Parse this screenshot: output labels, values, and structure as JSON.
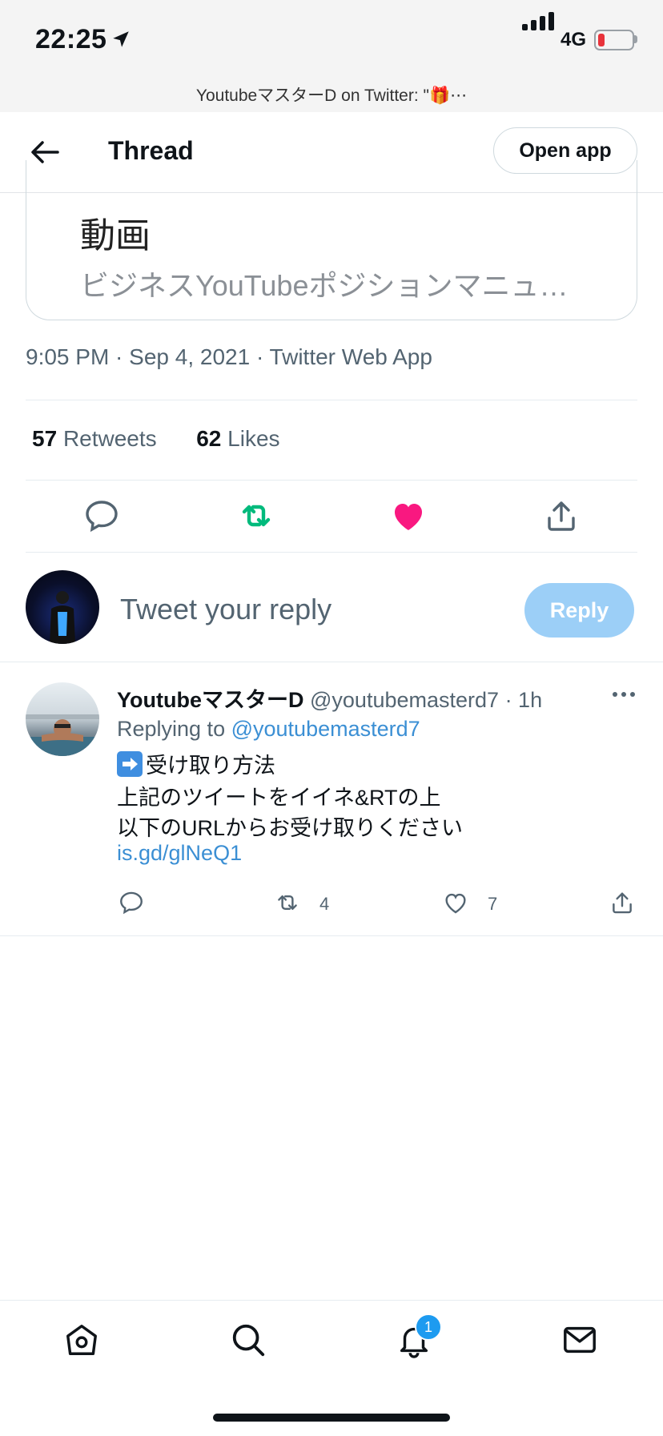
{
  "status_bar": {
    "time": "22:25",
    "network": "4G"
  },
  "browser": {
    "page_title": "Youtubeマスター‌D on Twitter: \"🎁⋯"
  },
  "header": {
    "title": "Thread",
    "open_app": "Open app"
  },
  "card": {
    "title": "動画",
    "description": "ビジネスYouTubeポジションマニュ…"
  },
  "tweet_meta": "9:05 PM · Sep 4, 2021 · Twitter Web App",
  "stats": {
    "retweets_count": "57",
    "retweets_label": "Retweets",
    "likes_count": "62",
    "likes_label": "Likes"
  },
  "reply_box": {
    "placeholder": "Tweet your reply",
    "button": "Reply"
  },
  "reply_tweet": {
    "name": "Youtubeマスター‌D",
    "handle": "@youtubemasterd7",
    "time": "· 1h",
    "replying_prefix": "Replying to",
    "replying_to": "@youtubemasterd7",
    "lines": [
      "受け取り方法",
      "上記のツイートをイイネ&RTの上",
      "以下のURLからお受け取りください"
    ],
    "link": "is.gd/glNeQ1",
    "retweets": "4",
    "likes": "7"
  },
  "bottom_nav": {
    "notifications_badge": "1"
  },
  "colors": {
    "accent": "#1d9bf0",
    "retweet_green": "#00ba7c",
    "like_pink": "#f91880",
    "text_secondary": "#536471"
  }
}
